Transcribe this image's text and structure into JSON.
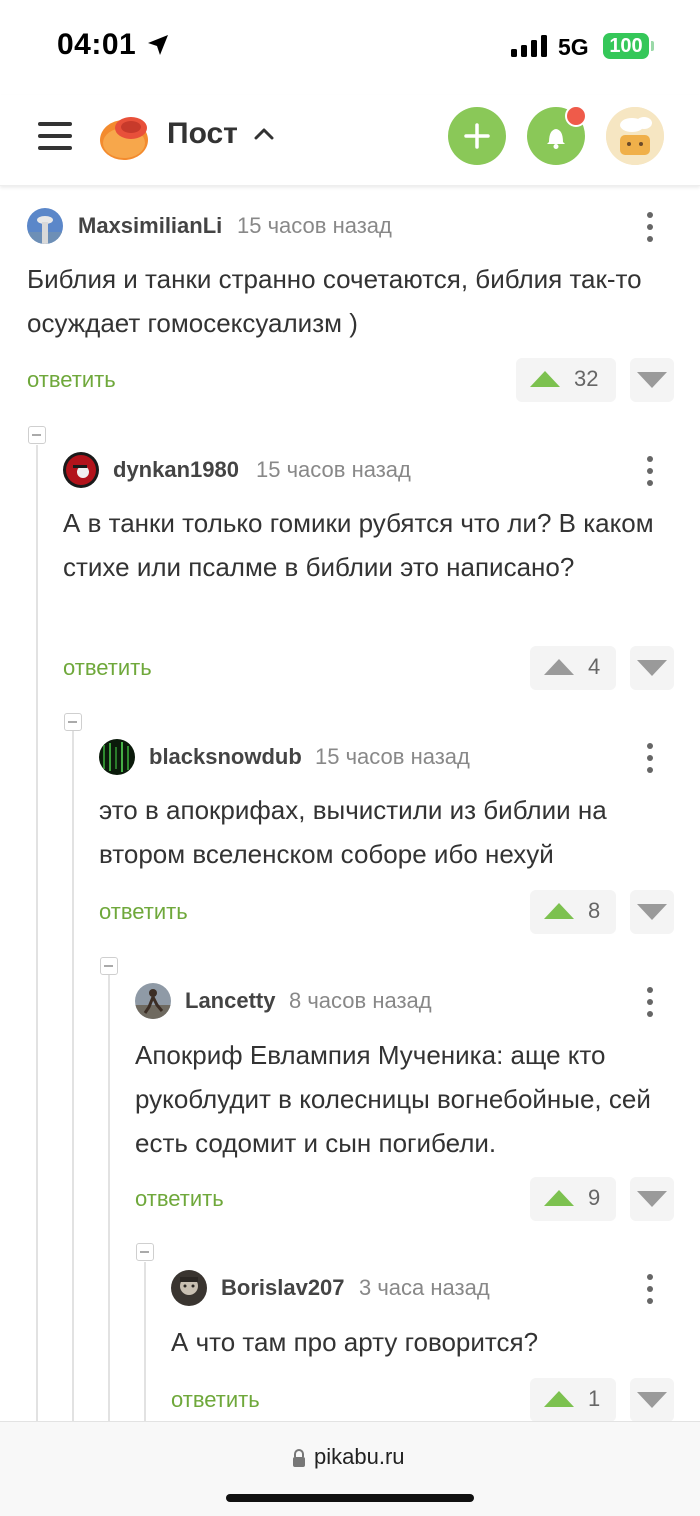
{
  "status_bar": {
    "time": "04:01",
    "network": "5G",
    "battery": "100"
  },
  "header": {
    "title": "Пост"
  },
  "comments": [
    {
      "user": "MaxsimilianLi",
      "time": "15 часов назад",
      "text": "Библия и танки странно сочетаются, библия так-то осуждает гомосексуализм )",
      "reply": "ответить",
      "votes": "32",
      "upvoted": true
    },
    {
      "user": "dynkan1980",
      "time": "15 часов назад",
      "text": "А в танки только гомики рубятся что ли? В каком стихе или псалме в библии это написано?",
      "reply": "ответить",
      "votes": "4",
      "upvoted": false
    },
    {
      "user": "blacksnowdub",
      "time": "15 часов назад",
      "text": "это в апокрифах, вычистили из библии на втором вселенском соборе ибо нехуй",
      "reply": "ответить",
      "votes": "8",
      "upvoted": true
    },
    {
      "user": "Lancetty",
      "time": "8 часов назад",
      "text": "Апокриф Евлампия Мученика: аще кто рукоблудит в колесницы вогнебойные, сей есть содомит и сын погибели.",
      "reply": "ответить",
      "votes": "9",
      "upvoted": true
    },
    {
      "user": "Borislav207",
      "time": "3 часа назад",
      "text": "А что там про арту говорится?",
      "reply": "ответить",
      "votes": "1",
      "upvoted": true
    }
  ],
  "url_bar": {
    "url": "pikabu.ru"
  },
  "colors": {
    "accent_green": "#8ac858",
    "reply_green": "#6fa83b",
    "upvote_green": "#7cc14f",
    "notification_red": "#ef5b4a"
  }
}
